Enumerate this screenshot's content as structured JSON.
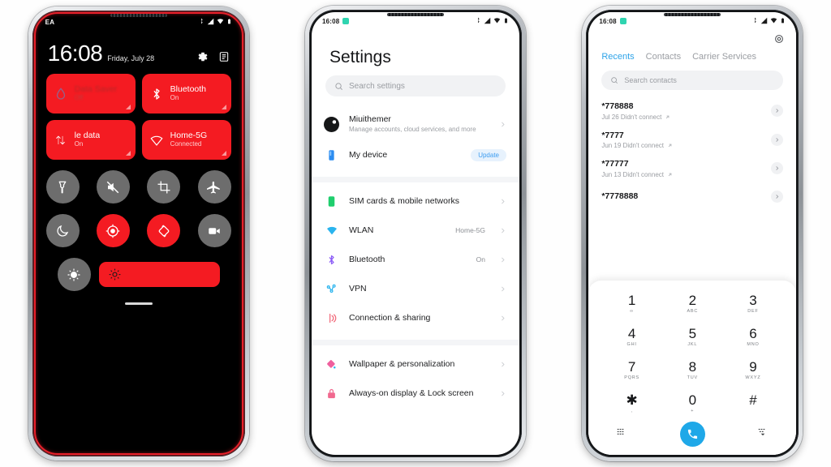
{
  "phone1": {
    "statusbar": {
      "carrier": "EA",
      "icons": [
        "bluetooth-icon",
        "signal-icon",
        "wifi-icon",
        "battery-icon"
      ]
    },
    "time": "16:08",
    "date": "Friday, July 28",
    "actions": [
      {
        "name": "settings-gear-icon",
        "label": "Settings"
      },
      {
        "name": "notification-list-icon",
        "label": "Notifications"
      }
    ],
    "tiles": [
      {
        "title": "Data Saver",
        "sub": "Off",
        "icon": "water-drop-icon",
        "state": "on",
        "obscured": true
      },
      {
        "title": "Bluetooth",
        "sub": "On",
        "icon": "bluetooth-icon",
        "state": "on",
        "obscured": false
      },
      {
        "title": "le data",
        "sub": "On",
        "icon": "mobile-data-arrows-icon",
        "state": "on",
        "obscured": false
      },
      {
        "title": "Home-5G",
        "sub": "Connected",
        "icon": "wifi-icon",
        "state": "on",
        "obscured": false
      }
    ],
    "toggles_row1": [
      {
        "name": "flashlight-icon",
        "label": "Flashlight",
        "on": false
      },
      {
        "name": "mute-icon",
        "label": "Silent",
        "on": false
      },
      {
        "name": "screenshot-icon",
        "label": "Screenshot",
        "on": false
      },
      {
        "name": "airplane-icon",
        "label": "Airplane mode",
        "on": false
      }
    ],
    "toggles_row2": [
      {
        "name": "moon-icon",
        "label": "Dark mode",
        "on": false
      },
      {
        "name": "location-icon",
        "label": "Location",
        "on": true
      },
      {
        "name": "auto-rotate-icon",
        "label": "Auto-rotate",
        "on": true
      },
      {
        "name": "screen-record-icon",
        "label": "Screen recorder",
        "on": false
      }
    ],
    "brightness": {
      "auto_icon": "auto-brightness-icon",
      "slider_icon": "sun-icon",
      "label": "Brightness"
    }
  },
  "phone2": {
    "statusbar": {
      "time": "16:08",
      "icons": [
        "bluetooth-icon",
        "signal-icon",
        "wifi-icon",
        "battery-icon"
      ]
    },
    "title": "Settings",
    "search": {
      "placeholder": "Search settings",
      "icon": "search-icon"
    },
    "groups": [
      {
        "rows": [
          {
            "title": "Miuithemer",
            "sub": "Manage accounts, cloud services, and more",
            "icon": "account-avatar-icon",
            "value": "",
            "badge": "",
            "chevron": true
          },
          {
            "title": "My device",
            "sub": "",
            "icon": "device-phone-icon",
            "value": "",
            "badge": "Update",
            "chevron": false
          }
        ]
      },
      {
        "rows": [
          {
            "title": "SIM cards & mobile networks",
            "sub": "",
            "icon": "sim-card-icon",
            "value": "",
            "badge": "",
            "chevron": true
          },
          {
            "title": "WLAN",
            "sub": "",
            "icon": "wifi-icon",
            "value": "Home-5G",
            "badge": "",
            "chevron": true
          },
          {
            "title": "Bluetooth",
            "sub": "",
            "icon": "bluetooth-icon",
            "value": "On",
            "badge": "",
            "chevron": true
          },
          {
            "title": "VPN",
            "sub": "",
            "icon": "vpn-icon",
            "value": "",
            "badge": "",
            "chevron": true
          },
          {
            "title": "Connection & sharing",
            "sub": "",
            "icon": "connection-sharing-icon",
            "value": "",
            "badge": "",
            "chevron": true
          }
        ]
      },
      {
        "rows": [
          {
            "title": "Wallpaper & personalization",
            "sub": "",
            "icon": "wallpaper-icon",
            "value": "",
            "badge": "",
            "chevron": true
          },
          {
            "title": "Always-on display & Lock screen",
            "sub": "",
            "icon": "lock-icon",
            "value": "",
            "badge": "",
            "chevron": true
          }
        ]
      }
    ]
  },
  "phone3": {
    "statusbar": {
      "time": "16:08",
      "icons": [
        "bluetooth-icon",
        "signal-icon",
        "wifi-icon",
        "battery-icon"
      ]
    },
    "settings_icon": "dialer-settings-gear-icon",
    "tabs": [
      {
        "label": "Recents",
        "active": true
      },
      {
        "label": "Contacts",
        "active": false
      },
      {
        "label": "Carrier Services",
        "active": false
      }
    ],
    "search": {
      "placeholder": "Search contacts",
      "icon": "search-icon"
    },
    "calls": [
      {
        "number": "*778888",
        "meta": "Jul 26 Didn't connect",
        "direction": "outgoing"
      },
      {
        "number": "*7777",
        "meta": "Jun 19 Didn't connect",
        "direction": "outgoing"
      },
      {
        "number": "*77777",
        "meta": "Jun 13 Didn't connect",
        "direction": "outgoing"
      },
      {
        "number": "*7778888",
        "meta": "",
        "direction": "outgoing"
      }
    ],
    "keys": [
      {
        "digit": "1",
        "letters": "∞"
      },
      {
        "digit": "2",
        "letters": "ABC"
      },
      {
        "digit": "3",
        "letters": "DEF"
      },
      {
        "digit": "4",
        "letters": "GHI"
      },
      {
        "digit": "5",
        "letters": "JKL"
      },
      {
        "digit": "6",
        "letters": "MNO"
      },
      {
        "digit": "7",
        "letters": "PQRS"
      },
      {
        "digit": "8",
        "letters": "TUV"
      },
      {
        "digit": "9",
        "letters": "WXYZ"
      },
      {
        "digit": "✱",
        "letters": ","
      },
      {
        "digit": "0",
        "letters": "+"
      },
      {
        "digit": "#",
        "letters": ""
      }
    ],
    "key_actions": [
      {
        "name": "call-log-list-icon",
        "label": "Call log"
      },
      {
        "name": "call-button",
        "label": "Call"
      },
      {
        "name": "hide-keypad-icon",
        "label": "Hide keypad"
      }
    ]
  },
  "colors": {
    "accent_red": "#f41b22",
    "accent_blue": "#2ea3e8",
    "call_blue": "#1fa8e8",
    "toggle_grey": "#6d6d6d",
    "dark_bg": "#000000",
    "light_bg": "#ffffff"
  }
}
